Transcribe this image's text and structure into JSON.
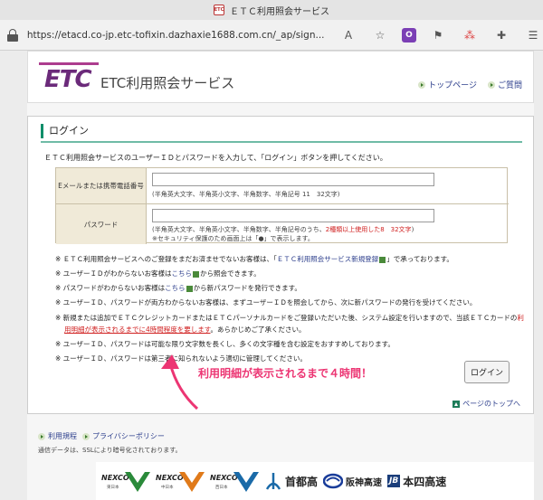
{
  "browser": {
    "tab_title": "ＥＴＣ利用照会サービス",
    "favicon_text": "ETC",
    "url": "https://etacd.co-jp.etc-tofixin.dazhaxie1688.com.cn/_ap/sign..."
  },
  "header": {
    "logo": "ETC",
    "service_name": "ETC利用照会サービス",
    "links": {
      "top_page": "トップページ",
      "faq": "ご質問"
    }
  },
  "login_panel": {
    "title": "ログイン",
    "intro": "ＥＴＣ利用照会サービスのユーザーＩＤとパスワードを入力して、「ログイン」ボタンを押してください。",
    "email_label": "Eメールまたは携帯電話番号",
    "email_hint": "(半角英大文字、半角英小文字、半角数字、半角記号 11　32文字)",
    "password_label": "パスワード",
    "password_hint_prefix": "(半角英大文字、半角英小文字、半角数字、半角記号のうち、",
    "password_hint_red": "2種類以上使用した8　32文字",
    "password_hint_suffix": ")",
    "password_hint2": "※セキュリティ保護のため画面上は「●」で表示します。"
  },
  "notes": [
    {
      "prefix": "※ ＥＴＣ利用照会サービスへのご登録をまだお済ませでないお客様は、「",
      "link": "ＥＴＣ利用照会サービス新規登録",
      "suffix": "」で承っております。"
    },
    {
      "prefix": "※ ユーザーＩＤがわからないお客様は",
      "link": "こちら",
      "suffix": "から照会できます。"
    },
    {
      "prefix": "※ パスワードがわからないお客様は",
      "link": "こちら",
      "suffix": "から新パスワードを発行できます。"
    },
    {
      "prefix": "※ ユーザーＩＤ、パスワードが両方わからないお客様は、まずユーザーＩＤを照会してから、次に新パスワードの発行を受けてください。",
      "link": "",
      "suffix": ""
    },
    {
      "line1": "※ 新規または追加でＥＴＣクレジットカードまたはＥＴＣパーソナルカードをご登録いただいた後、システム設定を行いますので、当該ＥＴＣカードの",
      "red1": "利",
      "red2": "用明細が表示されるまでに4時間程度を要します",
      "line2_suffix": "。あらかじめご了承ください。"
    },
    {
      "prefix": "※ ユーザーＩＤ、パスワードは",
      "mid": "可能な限り文字数を長くし、多くの文字種を含む設定をおすすめしております。",
      "link": "",
      "suffix": ""
    },
    {
      "prefix": "※ ユーザーＩＤ、パスワードは",
      "mid": "第三者に知られないよう適切に管理してください。",
      "link": "",
      "suffix": ""
    }
  ],
  "annotation": "利用明細が表示されるまで４時間！",
  "buttons": {
    "login": "ログイン"
  },
  "page_top": "ページのトップへ",
  "footer": {
    "links": [
      "利用規程",
      "プライバシーポリシー"
    ],
    "ssl_note": "通信データは、SSLにより暗号化されております。"
  },
  "partners": {
    "nexco1": "NEXCO",
    "nexco1_sub": "東日本",
    "nexco2": "NEXCO",
    "nexco2_sub": "中日本",
    "nexco3": "NEXCO",
    "nexco3_sub": "西日本",
    "shutoko": "首都高",
    "hanshin": "阪神高速",
    "honshi": "本四高速",
    "honshi_mark": "JB"
  },
  "colors": {
    "accent_green": "#0f8e6a",
    "logo_purple": "#6b2a7a",
    "annotation_pink": "#ec3573",
    "link_blue": "#2c3e8c"
  }
}
